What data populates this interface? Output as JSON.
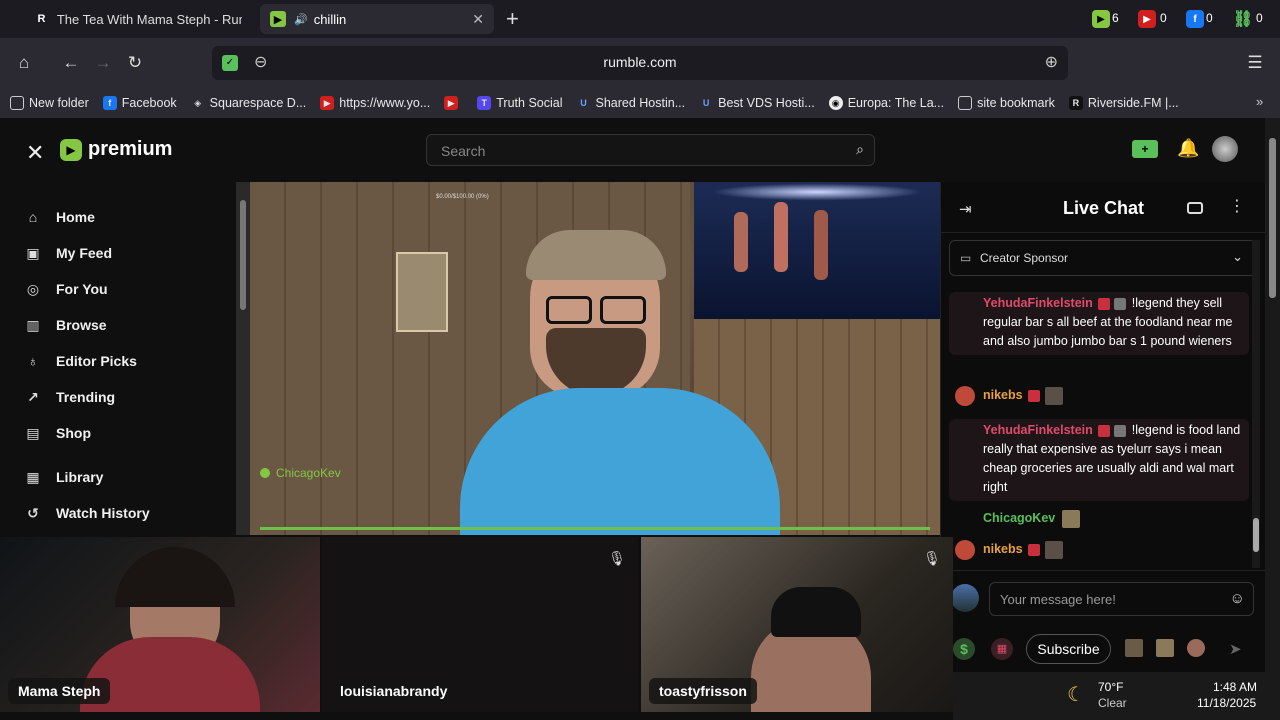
{
  "browser": {
    "tabs": [
      {
        "title": "The Tea With Mama Steph - Rumb",
        "icon": "rumble-r-icon"
      },
      {
        "title": "chillin",
        "icon": "rumble-play-icon"
      }
    ],
    "url": "rumble.com",
    "extension_counts": [
      "6",
      "0",
      "0",
      "0"
    ],
    "bookmarks": [
      "New folder",
      "Facebook",
      "Squarespace D...",
      "https://www.yo...",
      "",
      "Truth Social",
      "Shared Hostin...",
      "Best VDS Hosti...",
      "Europa: The La...",
      "site bookmark",
      "Riverside.FM |..."
    ]
  },
  "header": {
    "logo_text": "premium",
    "search_placeholder": "Search"
  },
  "sidebar": {
    "items": [
      {
        "label": "Home",
        "icon": "home-icon"
      },
      {
        "label": "My Feed",
        "icon": "feed-icon"
      },
      {
        "label": "For You",
        "icon": "target-icon"
      },
      {
        "label": "Browse",
        "icon": "browse-icon"
      },
      {
        "label": "Editor Picks",
        "icon": "award-icon"
      },
      {
        "label": "Trending",
        "icon": "trending-icon"
      },
      {
        "label": "Shop",
        "icon": "shop-icon"
      },
      {
        "label": "Library",
        "icon": "library-icon"
      },
      {
        "label": "Watch History",
        "icon": "history-icon"
      }
    ]
  },
  "video": {
    "donation_text": "$0.00/$100.00 (0%)",
    "overlay_name": "ChicagoKev"
  },
  "chat": {
    "title": "Live Chat",
    "sponsor_label": "Creator Sponsor",
    "messages": [
      {
        "user": "YehudaFinkelstein",
        "text": "!legend they sell regular bar s all beef at the foodland near me and also jumbo jumbo bar s 1 pound wieners"
      },
      {
        "user": "nikebs",
        "text": ""
      },
      {
        "user": "YehudaFinkelstein",
        "text": "!legend is food land really that expensive as tyelurr says i mean cheap groceries are usually aldi and wal mart right"
      },
      {
        "user": "ChicagoKev",
        "text": ""
      },
      {
        "user": "nikebs",
        "text": ""
      }
    ],
    "input_placeholder": "Your message here!",
    "subscribe_label": "Subscribe"
  },
  "participants": [
    {
      "name": "Mama Steph"
    },
    {
      "name": "louisianabrandy"
    },
    {
      "name": "toastyfrisson"
    }
  ],
  "taskbar": {
    "temp": "70°F",
    "condition": "Clear",
    "time": "1:48 AM",
    "date": "11/18/2025"
  },
  "colors": {
    "rumble_green": "#85c742",
    "chat_red": "#e14a6a",
    "chat_green": "#5bbf5b"
  }
}
